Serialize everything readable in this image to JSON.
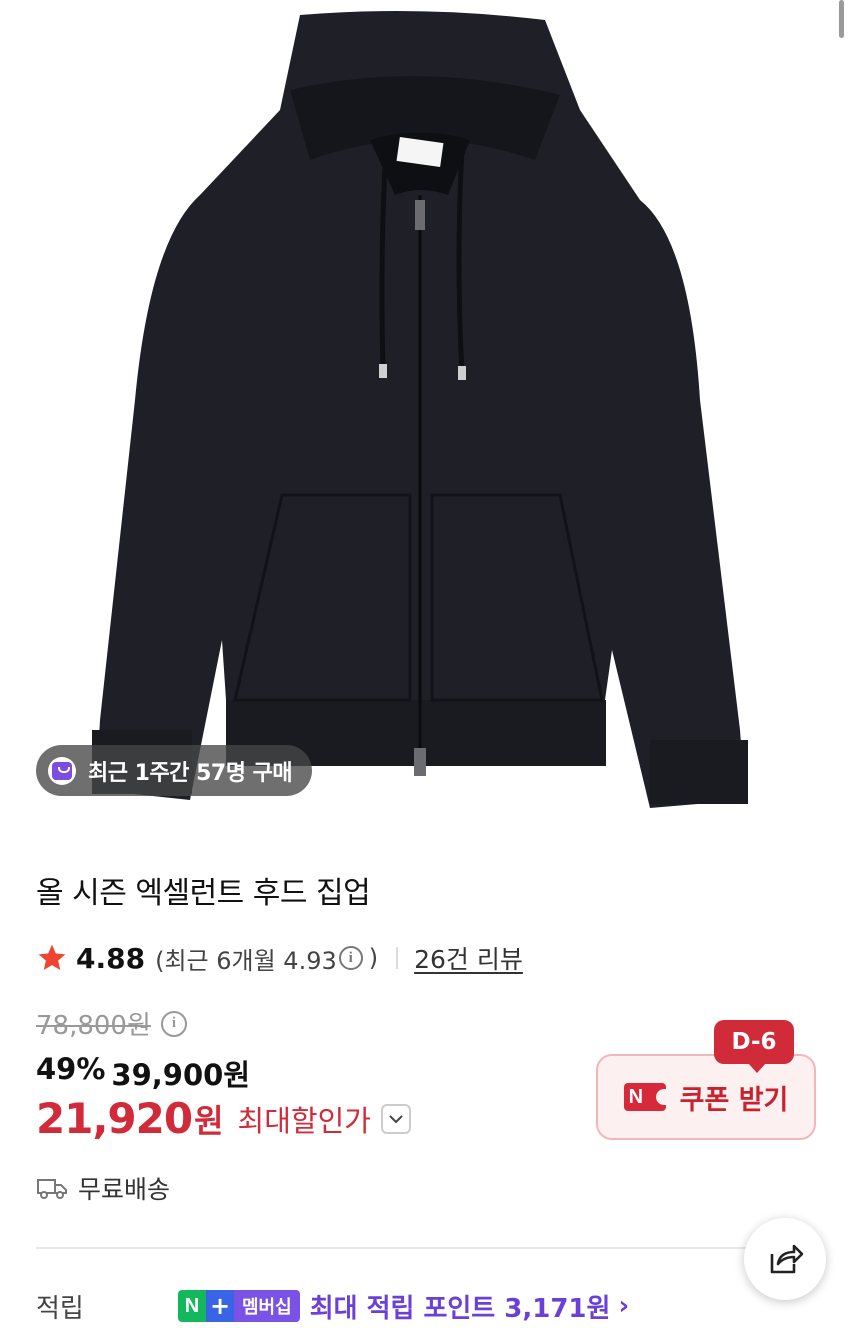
{
  "product": {
    "image_alt": "black zip-up hoodie",
    "purchase_badge": "최근 1주간 57명 구매",
    "title": "올 시즌 엑셀런트 후드 집업"
  },
  "rating": {
    "value": "4.88",
    "recent_prefix": "(최근 6개월 4.93",
    "recent_suffix": ")",
    "review_link": "26건 리뷰"
  },
  "price": {
    "original": "78,800원",
    "discount_rate": "49%",
    "discounted": "39,900원",
    "final_amount": "21,920",
    "final_unit": "원",
    "max_discount_label": "최대할인가"
  },
  "coupon": {
    "dday": "D-6",
    "badge": "N",
    "label": "쿠폰 받기"
  },
  "shipping": {
    "label": "무료배송"
  },
  "points": {
    "label": "적립",
    "badge_n": "N",
    "badge_plus": "+",
    "badge_membership": "멤버십",
    "text": "최대 적립 포인트 3,171원",
    "chevron": "›"
  },
  "colors": {
    "accent_red": "#d12b3a",
    "membership_purple": "#6b40d8",
    "n_green": "#14b85c"
  },
  "icons": [
    "bag-icon",
    "star-icon",
    "info-icon",
    "chevron-down-icon",
    "truck-icon",
    "share-icon",
    "chevron-right-icon"
  ]
}
